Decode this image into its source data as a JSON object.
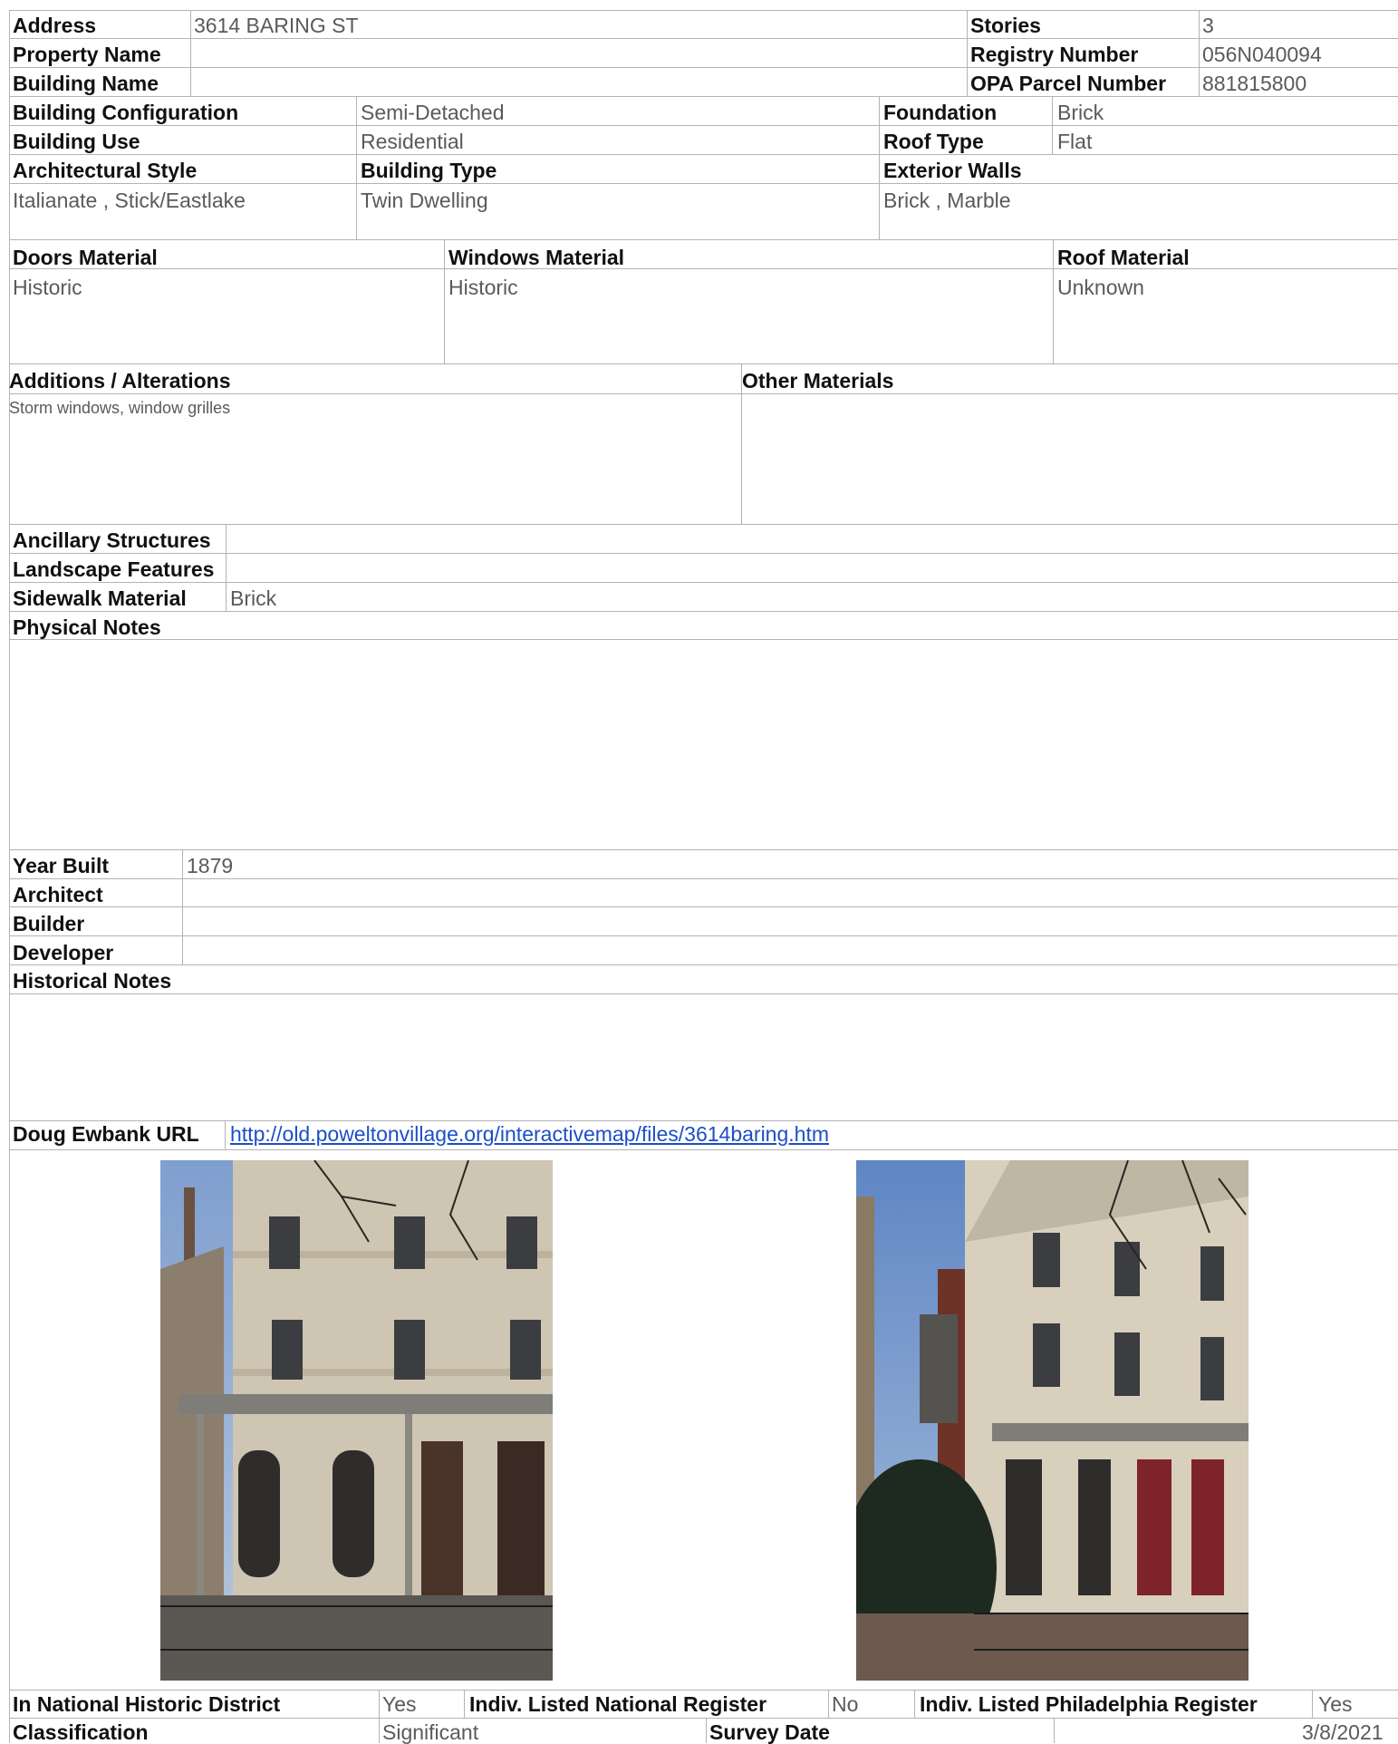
{
  "property": {
    "address_label": "Address",
    "address": "3614 BARING ST",
    "stories_label": "Stories",
    "stories": "3",
    "property_name_label": "Property Name",
    "property_name": "",
    "registry_label": "Registry Number",
    "registry": "056N040094",
    "building_name_label": "Building Name",
    "building_name": "",
    "opa_label": "OPA Parcel Number",
    "opa": "881815800"
  },
  "building": {
    "config_label": "Building Configuration",
    "config": "Semi-Detached",
    "foundation_label": "Foundation",
    "foundation": "Brick",
    "use_label": "Building Use",
    "use": "Residential",
    "roof_type_label": "Roof Type",
    "roof_type": "Flat",
    "arch_style_label": "Architectural Style",
    "arch_style": "Italianate , Stick/Eastlake",
    "type_label": "Building Type",
    "type": "Twin Dwelling",
    "ext_walls_label": "Exterior Walls",
    "ext_walls": "Brick , Marble"
  },
  "materials": {
    "doors_label": "Doors Material",
    "doors": "Historic",
    "windows_label": "Windows Material",
    "windows": "Historic",
    "roof_label": "Roof Material",
    "roof": "Unknown",
    "additions_label": "Additions / Alterations",
    "additions": "Storm windows, window grilles",
    "other_label": "Other Materials",
    "other": ""
  },
  "site": {
    "ancillary_label": "Ancillary Structures",
    "ancillary": "",
    "landscape_label": "Landscape Features",
    "landscape": "",
    "sidewalk_label": "Sidewalk Material",
    "sidewalk": "Brick",
    "physical_notes_label": "Physical Notes",
    "physical_notes": ""
  },
  "history": {
    "year_label": "Year Built",
    "year": "1879",
    "architect_label": "Architect",
    "architect": "",
    "builder_label": "Builder",
    "builder": "",
    "developer_label": "Developer",
    "developer": "",
    "notes_label": "Historical Notes",
    "notes": ""
  },
  "links": {
    "ewbank_label": "Doug Ewbank URL",
    "ewbank_url": "http://old.poweltonvillage.org/interactivemap/files/3614baring.htm"
  },
  "status": {
    "nat_district_label": "In National Historic District",
    "nat_district": "Yes",
    "nat_register_label": "Indiv. Listed National Register",
    "nat_register": "No",
    "phila_register_label": "Indiv. Listed Philadelphia Register",
    "phila_register": "Yes",
    "classification_label": "Classification",
    "classification": "Significant",
    "survey_date_label": "Survey Date",
    "survey_date": "3/8/2021"
  },
  "colors": {
    "label": "#111111",
    "value": "#5a5a5a",
    "link": "#1d4ec8",
    "grid": "#b3b3b3"
  }
}
